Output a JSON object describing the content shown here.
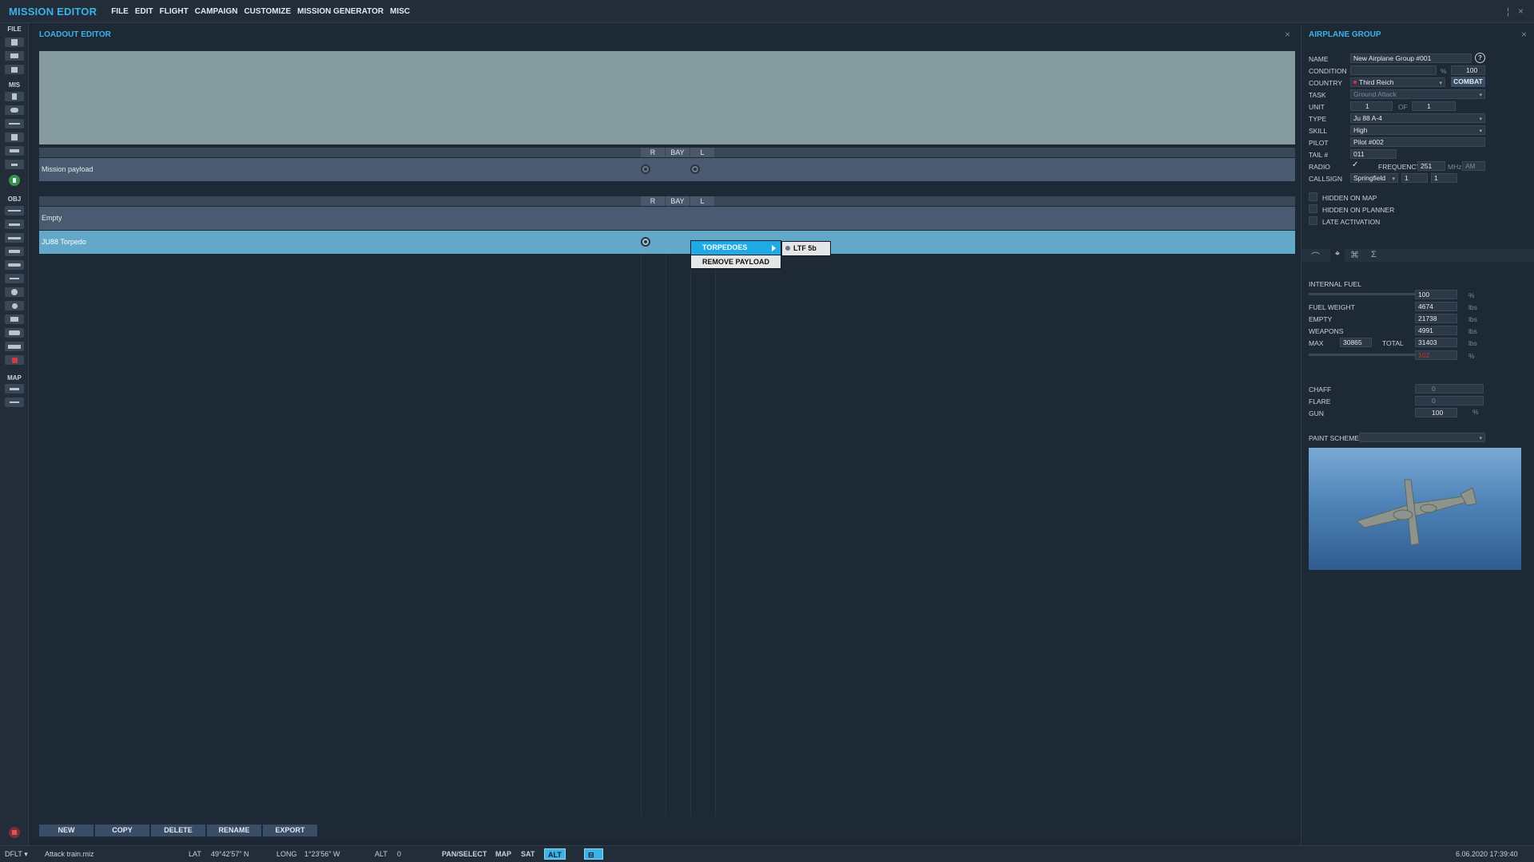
{
  "app": {
    "title": "MISSION EDITOR"
  },
  "menu": [
    "FILE",
    "EDIT",
    "FLIGHT",
    "CAMPAIGN",
    "CUSTOMIZE",
    "MISSION GENERATOR",
    "MISC"
  ],
  "left_toolbar": {
    "file_label": "FILE",
    "mis_label": "MIS",
    "obj_label": "OBJ",
    "map_label": "MAP"
  },
  "loadout": {
    "title": "LOADOUT EDITOR",
    "columns": [
      "R",
      "BAY",
      "L"
    ],
    "mission_payload_label": "Mission payload",
    "rows": [
      "Empty",
      "JU88 Torpedo"
    ],
    "context_menu": {
      "torpedoes": "TORPEDOES",
      "remove": "REMOVE PAYLOAD",
      "submenu_item": "LTF 5b"
    },
    "buttons": [
      "NEW",
      "COPY",
      "DELETE",
      "RENAME",
      "EXPORT"
    ]
  },
  "group": {
    "title": "AIRPLANE GROUP",
    "name_label": "NAME",
    "name_value": "New Airplane Group #001",
    "help": "?",
    "condition_label": "CONDITION",
    "condition_unit": "%",
    "condition_value": "100",
    "country_label": "COUNTRY",
    "country_value": "Third Reich",
    "combat_label": "COMBAT",
    "task_label": "TASK",
    "task_value": "Ground Attack",
    "unit_label": "UNIT",
    "unit_value": "1",
    "of_label": "OF",
    "of_value": "1",
    "type_label": "TYPE",
    "type_value": "Ju 88 A-4",
    "skill_label": "SKILL",
    "skill_value": "High",
    "pilot_label": "PILOT",
    "pilot_value": "Pilot #002",
    "tail_label": "TAIL #",
    "tail_value": "011",
    "radio_label": "RADIO",
    "frequency_label": "FREQUENCY",
    "frequency_value": "251",
    "frequency_unit": "MHz",
    "modulation": "AM",
    "callsign_label": "CALLSIGN",
    "callsign_value": "Springfield",
    "callsign_n1": "1",
    "callsign_n2": "1",
    "hidden_map_label": "HIDDEN ON MAP",
    "hidden_planner_label": "HIDDEN ON PLANNER",
    "late_activation_label": "LATE ACTIVATION"
  },
  "fuel": {
    "internal_fuel_label": "INTERNAL FUEL",
    "internal_fuel_value": "100",
    "internal_fuel_unit": "%",
    "internal_fuel_slider_fraction": 1.0,
    "fuel_weight_label": "FUEL WEIGHT",
    "fuel_weight_value": "4674",
    "empty_label": "EMPTY",
    "empty_value": "21738",
    "weapons_label": "WEAPONS",
    "weapons_value": "4991",
    "max_label": "MAX",
    "max_value": "30865",
    "total_label": "TOTAL",
    "total_value": "31403",
    "load_percent_value": "102",
    "load_slider_fraction": 1.0,
    "unit_lbs": "lbs",
    "unit_pct": "%",
    "chaff_label": "CHAFF",
    "chaff_value": "0",
    "flare_label": "FLARE",
    "flare_value": "0",
    "gun_label": "GUN",
    "gun_value": "100",
    "gun_unit": "%",
    "paint_label": "PAINT SCHEME"
  },
  "colors": {
    "accent": "#3bb3e8",
    "selected_row": "#63a7c9",
    "country_dot": "#e03030"
  },
  "status": {
    "profile": "DFLT",
    "mission_file": "Attack train.miz",
    "lat_label": "LAT",
    "lat_value": "49°42'57\" N",
    "long_label": "LONG",
    "long_value": "1°23'56\" W",
    "alt_label": "ALT",
    "alt_value": "0",
    "pan": "PAN/SELECT",
    "map": "MAP",
    "sat": "SAT",
    "alt_btn": "ALT",
    "datetime": "6.06.2020 17:39:40"
  }
}
